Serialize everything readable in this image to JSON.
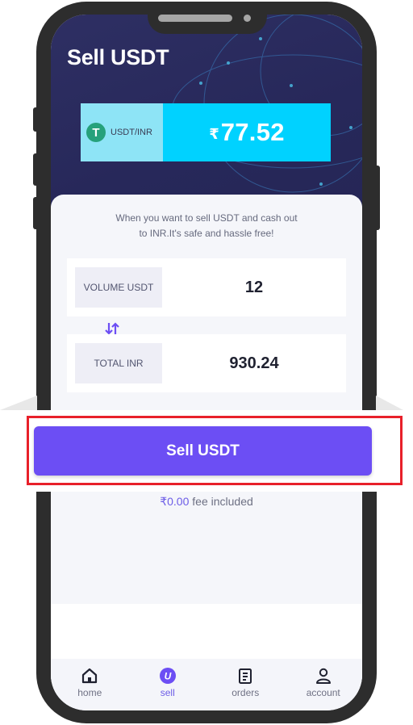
{
  "header": {
    "title": "Sell USDT"
  },
  "rate": {
    "pair": "USDT/INR",
    "currency_symbol": "₹",
    "value": "77.52",
    "icon": "tether-icon"
  },
  "intro": {
    "line1": "When you want to sell USDT and cash out",
    "line2": "to INR.It's safe and hassle free!"
  },
  "fields": {
    "volume": {
      "label": "VOLUME USDT",
      "value": "12"
    },
    "total": {
      "label": "TOTAL INR",
      "value": "930.24"
    }
  },
  "action": {
    "sell_label": "Sell USDT"
  },
  "fee": {
    "amount": "₹0.00",
    "text": "fee included"
  },
  "nav": [
    {
      "label": "home",
      "icon": "home-icon",
      "active": false
    },
    {
      "label": "sell",
      "icon": "sell-icon",
      "active": true
    },
    {
      "label": "orders",
      "icon": "orders-icon",
      "active": false
    },
    {
      "label": "account",
      "icon": "account-icon",
      "active": false
    }
  ],
  "colors": {
    "accent": "#6c4ef4",
    "rate_bg": "#00d2ff",
    "highlight": "#e8202a"
  }
}
